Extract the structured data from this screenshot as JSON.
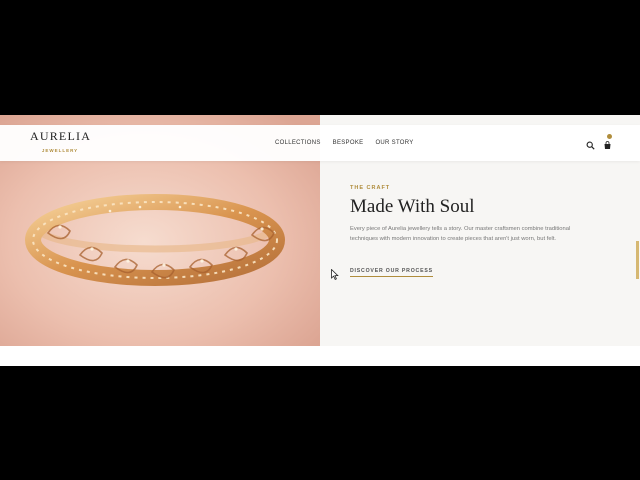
{
  "brand": {
    "name": "AURELIA",
    "tagline": "JEWELLERY"
  },
  "nav": {
    "items": [
      {
        "label": "COLLECTIONS"
      },
      {
        "label": "BESPOKE"
      },
      {
        "label": "OUR STORY"
      }
    ],
    "icons": [
      "search-icon",
      "cart-icon"
    ]
  },
  "hero": {
    "image_alt": "gold bracelet with diamond paisley motifs",
    "eyebrow": "THE CRAFT",
    "title": "Made With Soul",
    "body": "Every piece of Aurelia jewellery tells a story. Our master craftsmen combine traditional techniques with modern innovation to create pieces that aren't just worn, but felt.",
    "cta": "DISCOVER OUR PROCESS"
  },
  "colors": {
    "accent": "#b08d3c",
    "text_dark": "#222222",
    "text_muted": "#777777",
    "panel_bg": "#f7f6f4",
    "image_bg": "#eec4b6"
  }
}
